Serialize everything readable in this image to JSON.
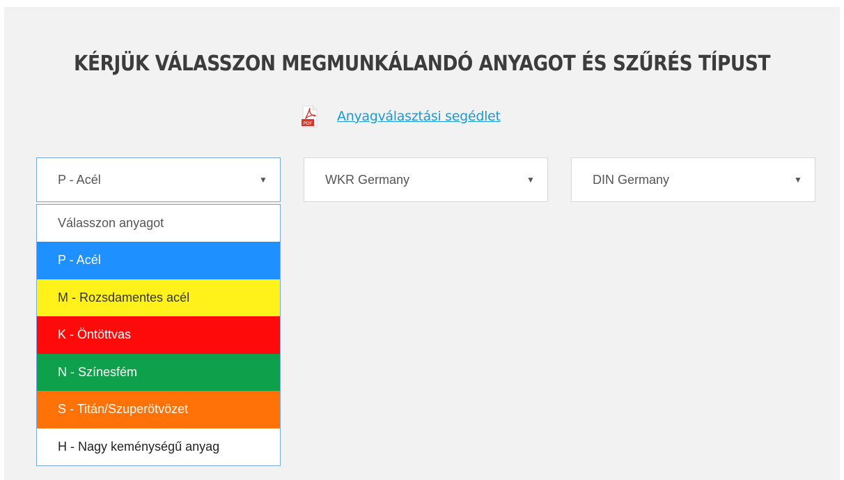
{
  "header": {
    "title": "KÉRJÜK VÁLASSZON MEGMUNKÁLANDÓ ANYAGOT ÉS SZŰRÉS TÍPUST",
    "pdf_icon": "pdf-file-icon",
    "pdf_icon_text": "PDF",
    "pdf_link": "Anyagválasztási segédlet"
  },
  "selects": {
    "material": {
      "value": "P - Acél"
    },
    "brand": {
      "value": "WKR Germany"
    },
    "standard": {
      "value": "DIN Germany"
    },
    "arrow": "▼"
  },
  "dropdown": {
    "options": [
      {
        "label": "Válasszon anyagot",
        "bg": "#ffffff",
        "fg": "#555555"
      },
      {
        "label": "P - Acél",
        "bg": "#1e90ff",
        "fg": "#ffffff"
      },
      {
        "label": "M - Rozsdamentes acél",
        "bg": "#fff11a",
        "fg": "#333333"
      },
      {
        "label": "K - Öntöttvas",
        "bg": "#ff0a0a",
        "fg": "#ffffff"
      },
      {
        "label": "N - Színesfém",
        "bg": "#0fa04b",
        "fg": "#ffffff"
      },
      {
        "label": "S - Titán/Szuperötvözet",
        "bg": "#ff7208",
        "fg": "#ffffff"
      },
      {
        "label": "H - Nagy keménységű anyag",
        "bg": "#ffffff",
        "fg": "#222222"
      }
    ]
  }
}
